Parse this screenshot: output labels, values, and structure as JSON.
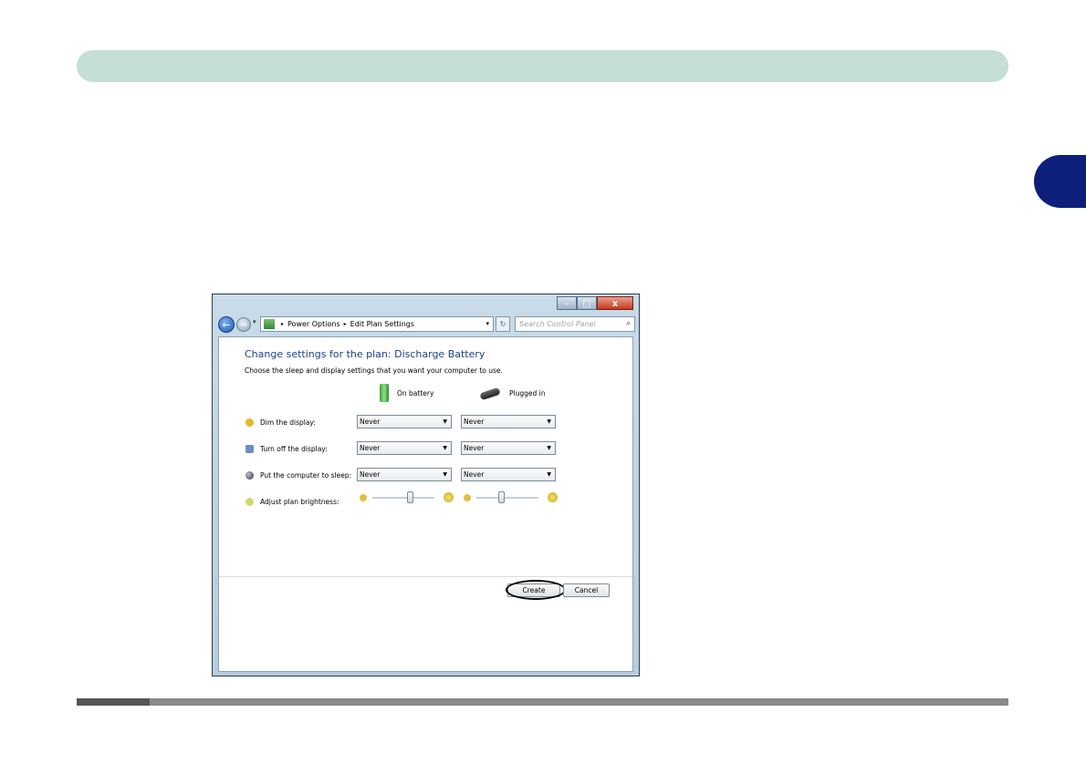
{
  "window": {
    "controls": {
      "minimize": "–",
      "maximize": "□",
      "close": "x"
    }
  },
  "nav": {
    "back": "←",
    "forward": "→",
    "drop": "▾",
    "breadcrumb": [
      "Power Options",
      "Edit Plan Settings"
    ],
    "breadcrumb_sep": "▸",
    "refresh": "↻",
    "search_placeholder": "Search Control Panel",
    "search_icon": "⌕"
  },
  "content": {
    "title": "Change settings for the plan: Discharge Battery",
    "subtitle": "Choose the sleep and display settings that you want your computer to use.",
    "columns": {
      "battery": "On battery",
      "plugged": "Plugged in"
    },
    "rows": [
      {
        "label": "Dim the display:",
        "on_battery": "Never",
        "plugged_in": "Never",
        "icon": "dim-display-icon",
        "icon_color": "#e5b82a"
      },
      {
        "label": "Turn off the display:",
        "on_battery": "Never",
        "plugged_in": "Never",
        "icon": "display-off-icon",
        "icon_color": "#6c8fbf"
      },
      {
        "label": "Put the computer to sleep:",
        "on_battery": "Never",
        "plugged_in": "Never",
        "icon": "sleep-icon",
        "icon_color": "#4a4a55"
      }
    ],
    "brightness": {
      "label": "Adjust plan brightness:",
      "on_battery": 0.6,
      "plugged_in": 0.4
    },
    "dropdown_arrow": "▼",
    "buttons": {
      "create": "Create",
      "cancel": "Cancel"
    }
  }
}
